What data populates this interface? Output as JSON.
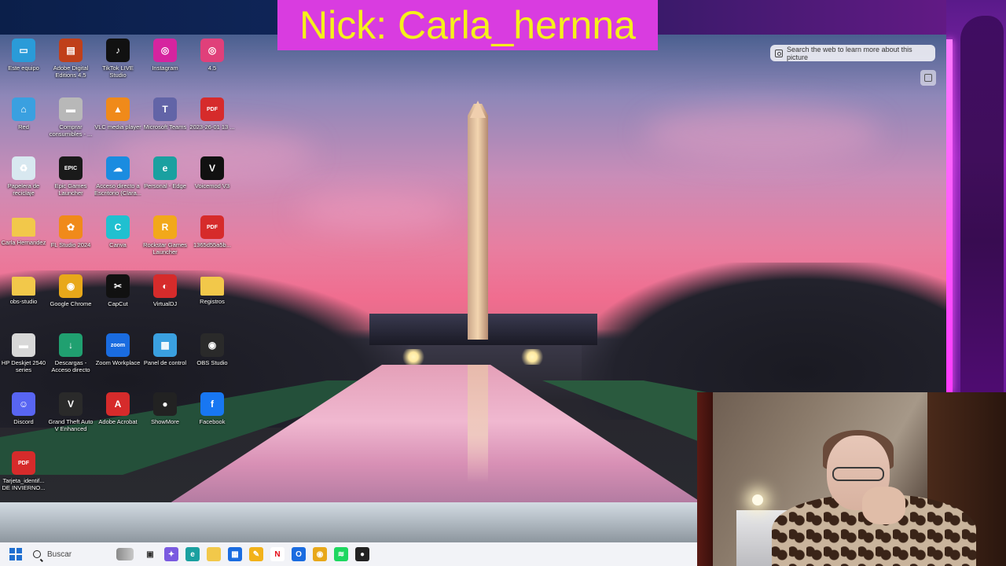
{
  "overlay": {
    "nick_label": "Nick: Carla_hernna"
  },
  "visual_search": {
    "label": "Search the web to learn more about this picture"
  },
  "desktop_icons": [
    {
      "name": "este-equipo",
      "label": "Este equipo",
      "icon": "monitor-icon",
      "color": "#2a9bd8"
    },
    {
      "name": "adobe-digital-editions",
      "label": "Adobe Digital Editions 4.5",
      "icon": "book-icon",
      "color": "#c0401a"
    },
    {
      "name": "tiktok-live-studio",
      "label": "TikTok LIVE Studio",
      "icon": "tiktok-icon",
      "color": "#111111"
    },
    {
      "name": "instagram",
      "label": "Instagram",
      "icon": "instagram-icon",
      "color": "#d6249f"
    },
    {
      "name": "app-45",
      "label": "4.5",
      "icon": "instagram-icon",
      "color": "#e0407a"
    },
    {
      "name": "red",
      "label": "Red",
      "icon": "network-icon",
      "color": "#3aa0e0"
    },
    {
      "name": "comprar-consumibles",
      "label": "Comprar consumibles - ...",
      "icon": "printer-icon",
      "color": "#b8b8b8"
    },
    {
      "name": "vlc",
      "label": "VLC media player",
      "icon": "vlc-cone-icon",
      "color": "#f08a1a"
    },
    {
      "name": "microsoft-teams",
      "label": "Microsoft Teams",
      "icon": "teams-icon",
      "color": "#6264a7"
    },
    {
      "name": "pdf-2023",
      "label": "2023-26-01 13 ...",
      "icon": "pdf-icon",
      "color": "#d62b2b"
    },
    {
      "name": "papelera",
      "label": "Papelera de reciclaje",
      "icon": "recycle-bin-icon",
      "color": "#d8e8f0"
    },
    {
      "name": "epic-games",
      "label": "Epic Games Launcher",
      "icon": "epic-games-icon",
      "color": "#1a1a1a"
    },
    {
      "name": "onedrive",
      "label": "Acceso directo a Escritorio (Clara...",
      "icon": "cloud-icon",
      "color": "#1a8ce0"
    },
    {
      "name": "edge-personal",
      "label": "Personal - Edge",
      "icon": "edge-icon",
      "color": "#1aa0a0"
    },
    {
      "name": "voicemod",
      "label": "Voicemod V3",
      "icon": "voicemod-icon",
      "color": "#111111"
    },
    {
      "name": "carla-hernandez",
      "label": "Carla Hernandez",
      "icon": "folder-icon",
      "color": "#f2c84a"
    },
    {
      "name": "fl-studio",
      "label": "FL Studio 2024",
      "icon": "fl-studio-icon",
      "color": "#f08a1a"
    },
    {
      "name": "canva",
      "label": "Canva",
      "icon": "canva-icon",
      "color": "#20c0d0"
    },
    {
      "name": "rockstar",
      "label": "Rockstar Games Launcher",
      "icon": "rockstar-icon",
      "color": "#f2a81a"
    },
    {
      "name": "pdf-1365",
      "label": "1365d55a5b...",
      "icon": "pdf-icon",
      "color": "#d62b2b"
    },
    {
      "name": "obs-studio-folder",
      "label": "obs-studio",
      "icon": "folder-icon",
      "color": "#f2c84a"
    },
    {
      "name": "google-chrome",
      "label": "Google Chrome",
      "icon": "chrome-icon",
      "color": "#e8a81a"
    },
    {
      "name": "capcut",
      "label": "CapCut",
      "icon": "capcut-icon",
      "color": "#111111"
    },
    {
      "name": "virtualdj",
      "label": "VirtualDJ",
      "icon": "virtualdj-icon",
      "color": "#d62b2b"
    },
    {
      "name": "registros",
      "label": "Registros",
      "icon": "folder-icon",
      "color": "#f2c84a"
    },
    {
      "name": "hp-deskjet",
      "label": "HP Deskjet 2540 series",
      "icon": "printer-icon",
      "color": "#d8d8d8"
    },
    {
      "name": "descargas",
      "label": "Descargas - Acceso directo",
      "icon": "download-icon",
      "color": "#20a070"
    },
    {
      "name": "zoom",
      "label": "Zoom Workplace",
      "icon": "zoom-icon",
      "color": "#1a6ce0"
    },
    {
      "name": "panel-control",
      "label": "Panel de control",
      "icon": "control-panel-icon",
      "color": "#3aa0e0"
    },
    {
      "name": "obs-studio",
      "label": "OBS Studio",
      "icon": "obs-icon",
      "color": "#2a2a2a"
    },
    {
      "name": "discord",
      "label": "Discord",
      "icon": "discord-icon",
      "color": "#5865f2"
    },
    {
      "name": "gta-v",
      "label": "Grand Theft Auto V Enhanced",
      "icon": "gta-icon",
      "color": "#2a2a2a"
    },
    {
      "name": "adobe-acrobat",
      "label": "Adobe Acrobat",
      "icon": "acrobat-icon",
      "color": "#d62b2b"
    },
    {
      "name": "showmore",
      "label": "ShowMore",
      "icon": "showmore-icon",
      "color": "#222222"
    },
    {
      "name": "facebook",
      "label": "Facebook",
      "icon": "facebook-icon",
      "color": "#1877f2"
    },
    {
      "name": "tarjeta-pdf",
      "label": "Tarjeta_identif... DE INVIERNO...",
      "icon": "pdf-icon",
      "color": "#d62b2b"
    }
  ],
  "taskbar": {
    "search_placeholder": "Buscar",
    "apps": [
      {
        "name": "task-view",
        "icon": "task-view-icon",
        "color": "#333333",
        "glyph": "▣"
      },
      {
        "name": "copilot",
        "icon": "copilot-icon",
        "color": "#7a5ae0",
        "glyph": "✦"
      },
      {
        "name": "edge",
        "icon": "edge-icon",
        "color": "#1aa0a0",
        "glyph": "e"
      },
      {
        "name": "file-explorer",
        "icon": "folder-icon",
        "color": "#f2c84a",
        "glyph": ""
      },
      {
        "name": "store",
        "icon": "store-icon",
        "color": "#1a6ce0",
        "glyph": "▦"
      },
      {
        "name": "sticky",
        "icon": "sticky-notes-icon",
        "color": "#f2b21a",
        "glyph": "✎"
      },
      {
        "name": "netflix",
        "icon": "netflix-icon",
        "color": "#ffffff",
        "glyph": "N"
      },
      {
        "name": "outlook",
        "icon": "outlook-icon",
        "color": "#1a6ce0",
        "glyph": "O"
      },
      {
        "name": "chrome",
        "icon": "chrome-icon",
        "color": "#e8a81a",
        "glyph": "◉"
      },
      {
        "name": "spotify",
        "icon": "spotify-icon",
        "color": "#1ed760",
        "glyph": "≋"
      },
      {
        "name": "obs",
        "icon": "obs-icon",
        "color": "#222222",
        "glyph": "●"
      }
    ]
  }
}
